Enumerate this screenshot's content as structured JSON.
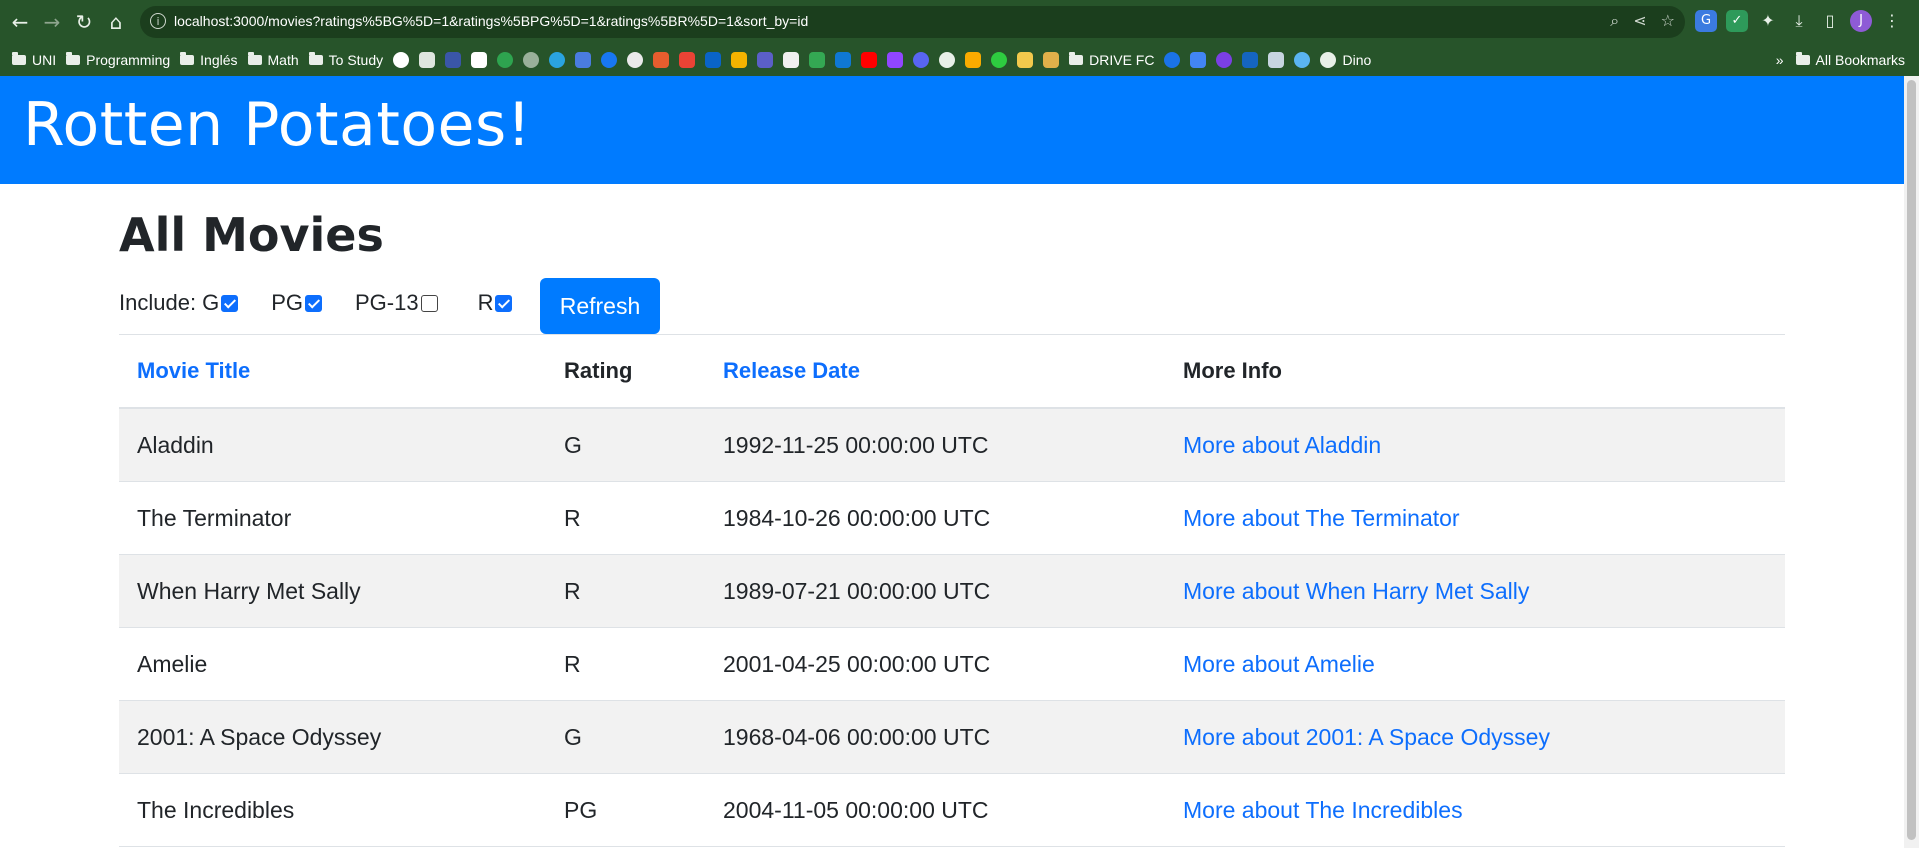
{
  "browser": {
    "url": "localhost:3000/movies?ratings%5BG%5D=1&ratings%5BPG%5D=1&ratings%5BR%5D=1&sort_by=id",
    "avatar_initial": "J",
    "bookmarks": [
      {
        "label": "UNI",
        "type": "folder"
      },
      {
        "label": "Programming",
        "type": "folder"
      },
      {
        "label": "Inglés",
        "type": "folder"
      },
      {
        "label": "Math",
        "type": "folder"
      },
      {
        "label": "To Study",
        "type": "folder"
      }
    ],
    "bookmarks_mid": [
      {
        "label": "DRIVE FC",
        "type": "folder"
      }
    ],
    "bookmark_dino": "Dino",
    "overflow": "»",
    "all_bookmarks": "All Bookmarks"
  },
  "app": {
    "title": "Rotten Potatoes!"
  },
  "page": {
    "title": "All Movies",
    "include_label": "Include:",
    "ratings": [
      {
        "label": "G",
        "checked": true
      },
      {
        "label": "PG",
        "checked": true
      },
      {
        "label": "PG-13",
        "checked": false
      },
      {
        "label": "R",
        "checked": true
      }
    ],
    "refresh_label": "Refresh"
  },
  "table": {
    "headers": {
      "title": "Movie Title",
      "rating": "Rating",
      "release_date": "Release Date",
      "more_info": "More Info"
    },
    "rows": [
      {
        "title": "Aladdin",
        "rating": "G",
        "release_date": "1992-11-25 00:00:00 UTC",
        "more": "More about Aladdin"
      },
      {
        "title": "The Terminator",
        "rating": "R",
        "release_date": "1984-10-26 00:00:00 UTC",
        "more": "More about The Terminator"
      },
      {
        "title": "When Harry Met Sally",
        "rating": "R",
        "release_date": "1989-07-21 00:00:00 UTC",
        "more": "More about When Harry Met Sally"
      },
      {
        "title": "Amelie",
        "rating": "R",
        "release_date": "2001-04-25 00:00:00 UTC",
        "more": "More about Amelie"
      },
      {
        "title": "2001: A Space Odyssey",
        "rating": "G",
        "release_date": "1968-04-06 00:00:00 UTC",
        "more": "More about 2001: A Space Odyssey"
      },
      {
        "title": "The Incredibles",
        "rating": "PG",
        "release_date": "2004-11-05 00:00:00 UTC",
        "more": "More about The Incredibles"
      }
    ]
  }
}
